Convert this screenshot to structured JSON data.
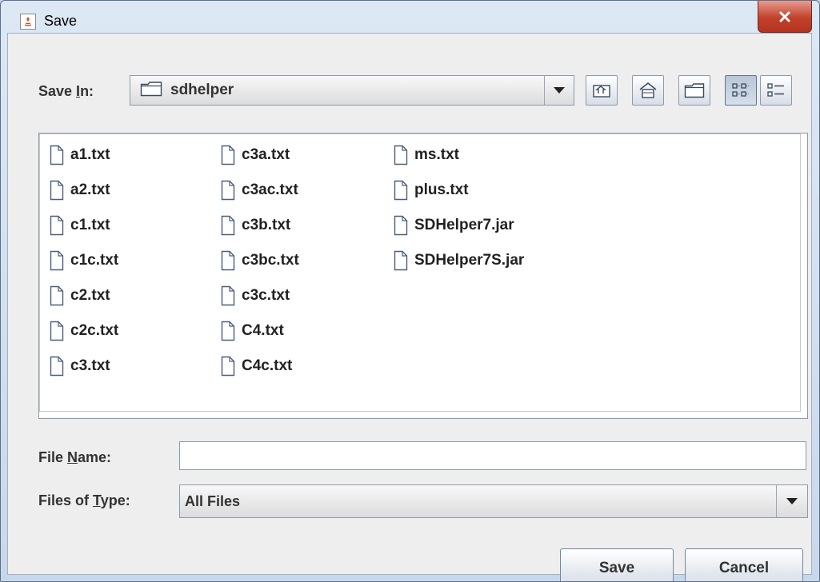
{
  "window": {
    "title": "Save"
  },
  "save_in": {
    "label_prefix": "Save ",
    "label_mnemonic": "I",
    "label_suffix": "n:",
    "value": "sdhelper"
  },
  "toolbar": {
    "buttons": [
      "up-one-level-icon",
      "home-icon",
      "new-folder-icon",
      "list-view-icon",
      "details-view-icon"
    ]
  },
  "files": {
    "col1": [
      "a1.txt",
      "a2.txt",
      "c1.txt",
      "c1c.txt",
      "c2.txt",
      "c2c.txt",
      "c3.txt"
    ],
    "col2": [
      "c3a.txt",
      "c3ac.txt",
      "c3b.txt",
      "c3bc.txt",
      "c3c.txt",
      "C4.txt",
      "C4c.txt"
    ],
    "col3": [
      "ms.txt",
      "plus.txt",
      "SDHelper7.jar",
      "SDHelper7S.jar"
    ]
  },
  "file_name": {
    "label_prefix": "File ",
    "label_mnemonic": "N",
    "label_suffix": "ame:",
    "value": ""
  },
  "file_type": {
    "label_prefix": "Files of ",
    "label_mnemonic": "T",
    "label_suffix": "ype:",
    "value": "All Files"
  },
  "actions": {
    "save": "Save",
    "cancel": "Cancel"
  }
}
